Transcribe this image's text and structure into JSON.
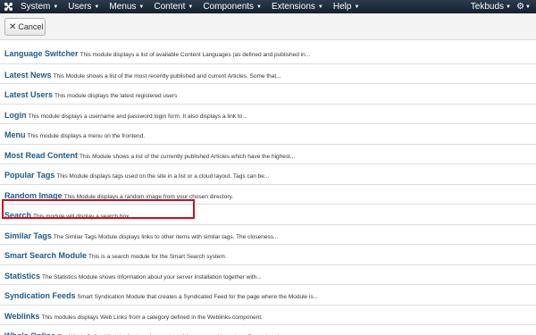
{
  "topbar": {
    "menu": [
      {
        "label": "System"
      },
      {
        "label": "Users"
      },
      {
        "label": "Menus"
      },
      {
        "label": "Content"
      },
      {
        "label": "Components"
      },
      {
        "label": "Extensions"
      },
      {
        "label": "Help"
      }
    ],
    "user": "Tekbuds"
  },
  "toolbar": {
    "cancel_label": "Cancel"
  },
  "modules": [
    {
      "title": "Language Switcher",
      "desc": "This module displays a list of available Content Languages (as defined and published in..."
    },
    {
      "title": "Latest News",
      "desc": "This Module shows a list of the most recently published and current Articles. Some that..."
    },
    {
      "title": "Latest Users",
      "desc": "This module displays the latest registered users"
    },
    {
      "title": "Login",
      "desc": "This module displays a username and password login form. It also displays a link to..."
    },
    {
      "title": "Menu",
      "desc": "This module displays a menu on the frontend."
    },
    {
      "title": "Most Read Content",
      "desc": "This Module shows a list of the currently published Articles which have the highest..."
    },
    {
      "title": "Popular Tags",
      "desc": "This Module displays tags used on the site in a list or a cloud layout. Tags can be..."
    },
    {
      "title": "Random Image",
      "desc": "This Module displays a random image from your chosen directory."
    },
    {
      "title": "Search",
      "desc": "This module will display a search box."
    },
    {
      "title": "Similar Tags",
      "desc": "The Similar Tags Module displays links to other items with similar tags. The closeness..."
    },
    {
      "title": "Smart Search Module",
      "desc": "This is a search module for the Smart Search system."
    },
    {
      "title": "Statistics",
      "desc": "The Statistics Module shows information about your server installation together with..."
    },
    {
      "title": "Syndication Feeds",
      "desc": "Smart Syndication Module that creates a Syndicated Feed for the page where the Module is..."
    },
    {
      "title": "Weblinks",
      "desc": "This modules displays Web Links from a category defined in the Weblinks component."
    },
    {
      "title": "Who's Online",
      "desc": "The Who's Online Module displays the number of Anonymous Users (e.g. Guests) and..."
    }
  ]
}
